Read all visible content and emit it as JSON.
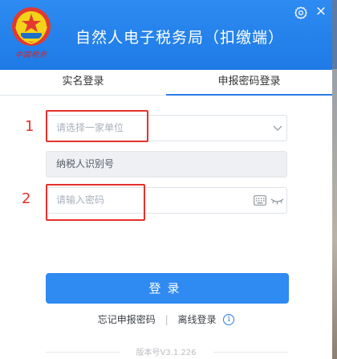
{
  "header": {
    "title": "自然人电子税务局（扣缴端）",
    "emblem_text": "中国税务",
    "settings_icon": "gear-icon",
    "close_label": "×"
  },
  "tabs": [
    {
      "label": "实名登录",
      "active": false
    },
    {
      "label": "申报密码登录",
      "active": true
    }
  ],
  "form": {
    "unit_select": {
      "placeholder": "请选择一家单位",
      "icon": "chevron-down-icon"
    },
    "taxpayer_id": {
      "value": "纳税人识别号"
    },
    "password": {
      "placeholder": "请输入密码",
      "icons": [
        "keyboard-icon",
        "eye-closed-icon"
      ]
    }
  },
  "annotations": {
    "marker_1": "1",
    "marker_2": "2"
  },
  "login_button": "登录",
  "links": {
    "forgot": "忘记申报密码",
    "separator": "|",
    "offline": "离线登录",
    "info_icon": "i"
  },
  "footer": {
    "version": "版本号V3.1.226"
  },
  "colors": {
    "header_blue": "#2d8bf1",
    "button_blue": "#2f8af2",
    "highlight_red": "#e4312b"
  }
}
